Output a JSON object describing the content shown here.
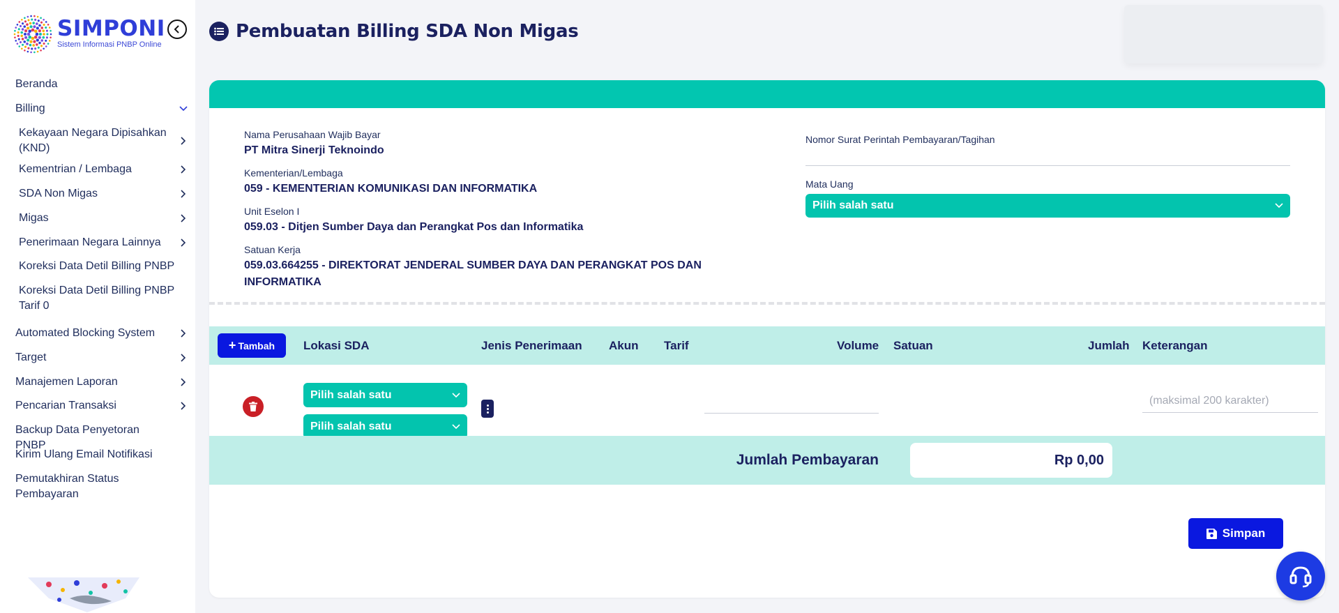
{
  "app": {
    "name": "SIMPONI",
    "subtitle": "Sistem Informasi PNBP Online"
  },
  "sidebar": {
    "items": [
      {
        "label": "Beranda",
        "chevron": ""
      },
      {
        "label": "Billing",
        "chevron": "down"
      },
      {
        "label": "Kekayaan Negara Dipisahkan (KND)",
        "chevron": "right"
      },
      {
        "label": "Kementrian / Lembaga",
        "chevron": "right"
      },
      {
        "label": "SDA Non Migas",
        "chevron": "right"
      },
      {
        "label": "Migas",
        "chevron": "right"
      },
      {
        "label": "Penerimaan Negara Lainnya",
        "chevron": "right"
      },
      {
        "label": "Koreksi Data Detil Billing PNBP",
        "chevron": ""
      },
      {
        "label": "Koreksi Data Detil Billing PNBP Tarif 0",
        "chevron": ""
      },
      {
        "label": "Automated Blocking System",
        "chevron": "right"
      },
      {
        "label": "Target",
        "chevron": "right"
      },
      {
        "label": "Manajemen Laporan",
        "chevron": "right"
      },
      {
        "label": "Pencarian Transaksi",
        "chevron": "right"
      },
      {
        "label": "Backup Data Penyetoran PNBP",
        "chevron": ""
      },
      {
        "label": "Kirim Ulang Email Notifikasi",
        "chevron": ""
      },
      {
        "label": "Pemutakhiran Status Pembayaran",
        "chevron": ""
      }
    ]
  },
  "header": {
    "title": "Pembuatan Billing SDA Non Migas"
  },
  "form": {
    "nama_perusahaan_label": "Nama Perusahaan Wajib Bayar",
    "nama_perusahaan_value": "PT Mitra Sinerji Teknoindo",
    "kementerian_label": "Kementerian/Lembaga",
    "kementerian_value": "059 - KEMENTERIAN KOMUNIKASI DAN INFORMATIKA",
    "eselon_label": "Unit Eselon I",
    "eselon_value": "059.03 - Ditjen Sumber Daya dan Perangkat Pos dan Informatika",
    "satker_label": "Satuan Kerja",
    "satker_value": "059.03.664255 - DIREKTORAT JENDERAL SUMBER DAYA DAN PERANGKAT POS DAN INFORMATIKA",
    "nomor_surat_label": "Nomor Surat Perintah Pembayaran/Tagihan",
    "nomor_surat_value": "",
    "mata_uang_label": "Mata Uang",
    "mata_uang_value": "Pilih salah satu"
  },
  "table": {
    "add_label": "Tambah",
    "columns": {
      "lokasi": "Lokasi SDA",
      "jenis": "Jenis Penerimaan",
      "akun": "Akun",
      "tarif": "Tarif",
      "volume": "Volume",
      "satuan": "Satuan",
      "jumlah": "Jumlah",
      "keterangan": "Keterangan"
    },
    "row": {
      "lokasi_select": "Pilih salah satu",
      "jenis_select": "Pilih salah satu",
      "volume": "",
      "keterangan_placeholder": "(maksimal 200 karakter)"
    }
  },
  "total": {
    "label": "Jumlah Pembayaran",
    "value": "Rp 0,00"
  },
  "actions": {
    "save_label": "Simpan"
  },
  "colors": {
    "primary": "#0a18e0",
    "teal": "#03c4ae",
    "teal_light": "#bfeee8",
    "navy": "#1b2160",
    "danger": "#c91f26"
  },
  "icons": {
    "logo": "simponi-logo-icon",
    "collapse": "chevron-left-circle-icon",
    "title": "list-icon",
    "delete": "trash-icon",
    "more": "more-vertical-icon",
    "save": "save-icon",
    "help": "headset-icon"
  }
}
